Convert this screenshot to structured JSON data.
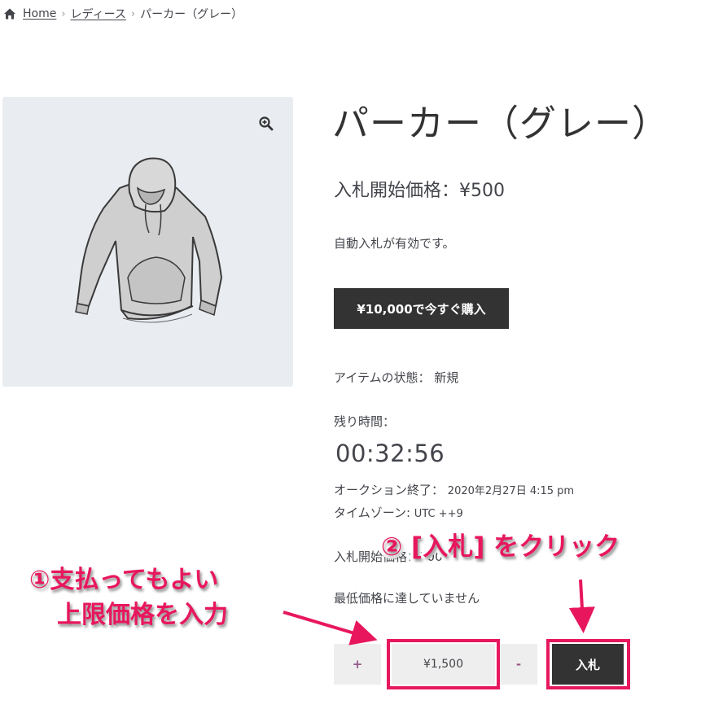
{
  "breadcrumb": {
    "home_icon": "home-icon",
    "home": "Home",
    "category": "レディース",
    "current": "パーカー（グレー）"
  },
  "product": {
    "title": "パーカー（グレー）",
    "image_alt": "hoodie-image",
    "zoom_icon": "zoom-in-icon",
    "start_price_label": "入札開始価格：",
    "start_price_value": "¥500",
    "auto_bid_text": "自動入札が有効です。",
    "buy_now_label": "¥10,000で今すぐ購入",
    "condition_label": "アイテムの状態：",
    "condition_value": "新規",
    "remaining_label": "残り時間：",
    "countdown": "00:32:56",
    "auction_end_label": "オークション終了：",
    "auction_end_value": "2020年2月27日 4:15 pm",
    "timezone_label": "タイムゾーン: ",
    "timezone_value": "UTC ++9",
    "start_line_visible": "入札開始価格：500",
    "reserve_text": "最低価格に達していません"
  },
  "bid_form": {
    "plus_label": "+",
    "input_value": "¥1,500",
    "minus_label": "-",
    "bid_button_label": "入札"
  },
  "annotations": {
    "step1_line1": "①支払ってもよい",
    "step1_line2": "上限価格を入力",
    "step2": "② [入札] をクリック",
    "accent_color": "#e8175d"
  },
  "colors": {
    "dark_button": "#333333",
    "image_bg": "#e9edf1",
    "control_bg": "#eeeeee"
  }
}
